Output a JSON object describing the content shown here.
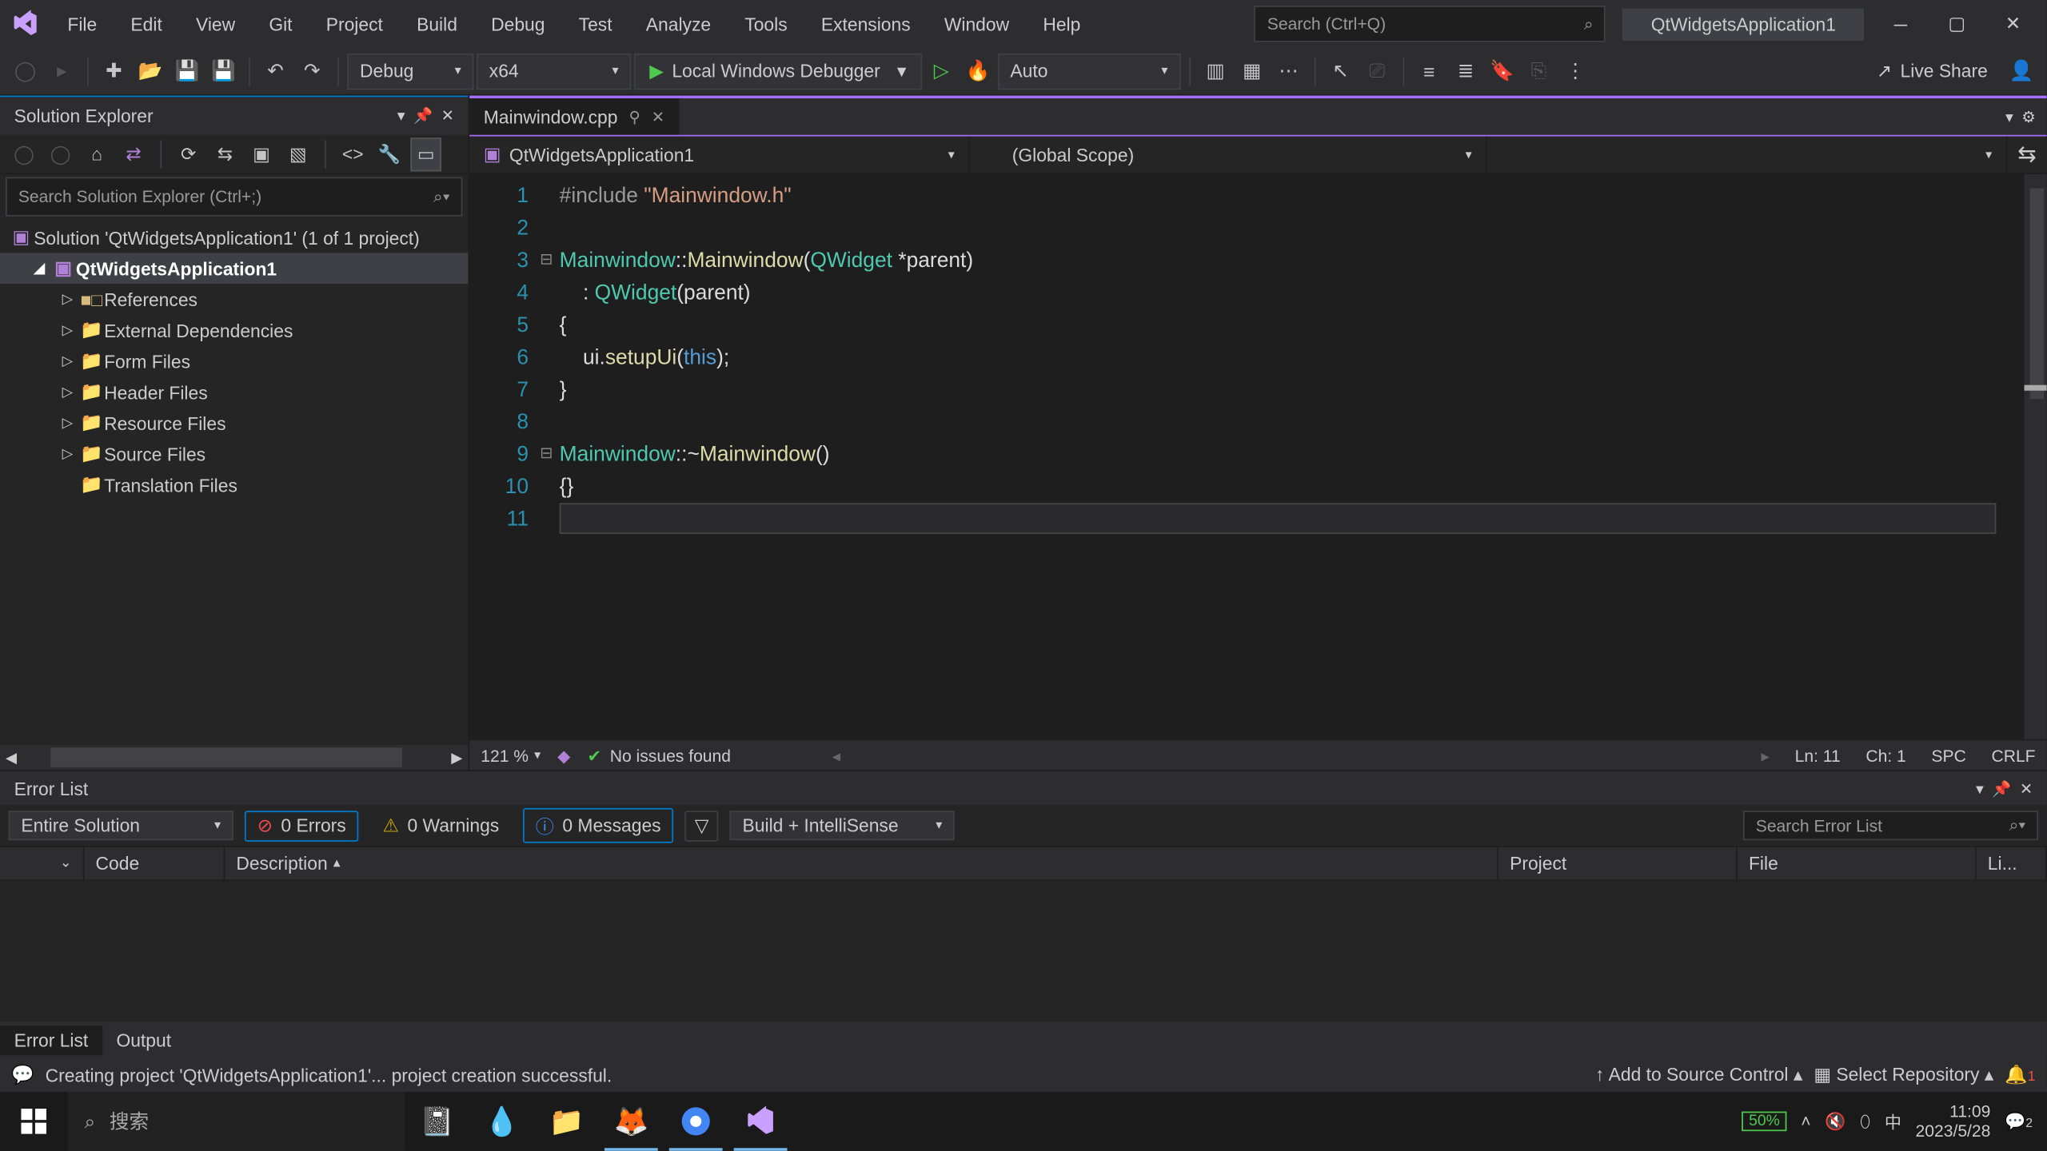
{
  "menubar": {
    "items": [
      "File",
      "Edit",
      "View",
      "Git",
      "Project",
      "Build",
      "Debug",
      "Test",
      "Analyze",
      "Tools",
      "Extensions",
      "Window",
      "Help"
    ],
    "search_placeholder": "Search (Ctrl+Q)",
    "app_name": "QtWidgetsApplication1"
  },
  "toolbar": {
    "config": "Debug",
    "platform": "x64",
    "run": "Local Windows Debugger",
    "auto": "Auto",
    "live_share": "Live Share"
  },
  "solution_explorer": {
    "title": "Solution Explorer",
    "search_placeholder": "Search Solution Explorer (Ctrl+;)",
    "root": "Solution 'QtWidgetsApplication1' (1 of 1 project)",
    "project": "QtWidgetsApplication1",
    "folders": [
      "References",
      "External Dependencies",
      "Form Files",
      "Header Files",
      "Resource Files",
      "Source Files",
      "Translation Files"
    ]
  },
  "editor": {
    "tab_name": "Mainwindow.cpp",
    "nav_project": "QtWidgetsApplication1",
    "nav_scope": "(Global Scope)",
    "code_lines": [
      {
        "n": "1",
        "fold": "",
        "html": "<span class='kw-pp'>#include </span><span class='kw-str'>\"Mainwindow.h\"</span>"
      },
      {
        "n": "2",
        "fold": "",
        "html": ""
      },
      {
        "n": "3",
        "fold": "⊟",
        "html": "<span class='kw-type'>Mainwindow</span><span class='kw-op'>::</span><span class='kw-func'>Mainwindow</span><span class='kw-op'>(</span><span class='kw-type'>QWidget</span><span class='kw-op'> *</span><span class='kw-op'>parent)</span>"
      },
      {
        "n": "4",
        "fold": "",
        "html": "    <span class='kw-op'>: </span><span class='kw-type'>QWidget</span><span class='kw-op'>(parent)</span>"
      },
      {
        "n": "5",
        "fold": "",
        "html": "<span class='kw-op'>{</span>"
      },
      {
        "n": "6",
        "fold": "",
        "html": "    <span class='kw-op'>ui.</span><span class='kw-func'>setupUi</span><span class='kw-op'>(</span><span class='kw-key'>this</span><span class='kw-op'>);</span>"
      },
      {
        "n": "7",
        "fold": "",
        "html": "<span class='kw-op'>}</span>"
      },
      {
        "n": "8",
        "fold": "",
        "html": ""
      },
      {
        "n": "9",
        "fold": "⊟",
        "html": "<span class='kw-type'>Mainwindow</span><span class='kw-op'>::~</span><span class='kw-func'>Mainwindow</span><span class='kw-op'>()</span>"
      },
      {
        "n": "10",
        "fold": "",
        "html": "<span class='kw-op'>{}</span>"
      },
      {
        "n": "11",
        "fold": "",
        "html": ""
      }
    ],
    "current_line_index": 10,
    "status": {
      "zoom": "121 %",
      "issues": "No issues found",
      "ln": "Ln: 11",
      "ch": "Ch: 1",
      "indent": "SPC",
      "eol": "CRLF"
    }
  },
  "error_list": {
    "title": "Error List",
    "scope": "Entire Solution",
    "errors": "0 Errors",
    "warnings": "0 Warnings",
    "messages": "0 Messages",
    "source": "Build + IntelliSense",
    "search_placeholder": "Search Error List",
    "columns": [
      "",
      "Code",
      "Description",
      "Project",
      "File",
      "Li..."
    ],
    "tabs": [
      "Error List",
      "Output"
    ]
  },
  "statusbar": {
    "message": "Creating project 'QtWidgetsApplication1'... project creation successful.",
    "source_control": "Add to Source Control",
    "repo": "Select Repository"
  },
  "taskbar": {
    "search": "搜索",
    "battery": "50%",
    "ime": "中",
    "time": "11:09",
    "date": "2023/5/28",
    "notif": "2"
  }
}
